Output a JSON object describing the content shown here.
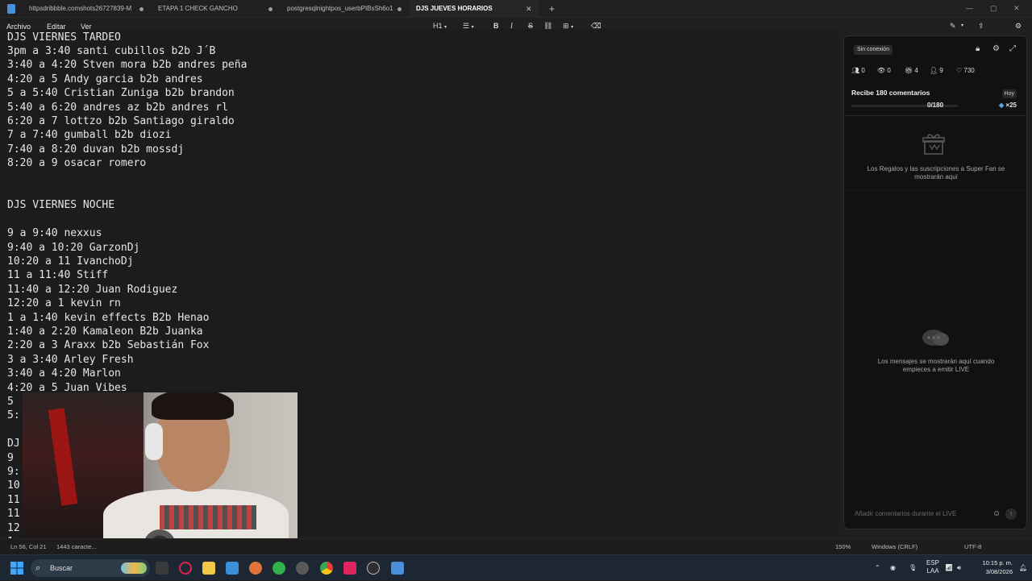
{
  "tabs": [
    {
      "label": "httpsdribbble.comshots26727839-M"
    },
    {
      "label": "ETAPA 1 CHECK GANCHO"
    },
    {
      "label": "postgresqlnightpos_userbPIBsSh6o1"
    },
    {
      "label": "DJS JUEVES HORARIOS"
    }
  ],
  "tab_add": "+",
  "window_controls": {
    "minimize": "—",
    "maximize": "▢",
    "close": "✕"
  },
  "menu": {
    "file": "Archivo",
    "edit": "Editar",
    "view": "Ver"
  },
  "format": {
    "heading": "H1",
    "bold": "B",
    "italic": "I",
    "strike": "S"
  },
  "document": {
    "lines": [
      "DJS VIERNES TARDEO",
      "3pm a 3:40 santi cubillos b2b J´B",
      "3:40 a 4:20 Stven mora b2b andres peña",
      "4:20 a 5 Andy garcia b2b andres",
      "5 a 5:40 Cristian Zuniga b2b brandon",
      "5:40 a 6:20 andres az b2b andres rl",
      "6:20 a 7 lottzo b2b Santiago giraldo",
      "7 a 7:40 gumball b2b diozi",
      "7:40 a 8:20 duvan b2b mossdj",
      "8:20 a 9 osacar romero",
      "",
      "",
      "DJS VIERNES NOCHE",
      "",
      "9 a 9:40 nexxus",
      "9:40 a 10:20 GarzonDj",
      "10:20 a 11 IvanchoDj",
      "11 a 11:40 Stiff",
      "11:40 a 12:20 Juan Rodiguez",
      "12:20 a 1 kevin rn",
      "1 a 1:40 kevin effects B2b Henao",
      "1:40 a 2:20 Kamaleon B2b Juanka",
      "2:20 a 3 Araxx b2b Sebastián Fox",
      "3 a 3:40 Arley Fresh",
      "3:40 a 4:20 Marlon",
      "4:20 a 5 Juan Vibes",
      "5",
      "5:",
      "",
      "DJ",
      "9",
      "9:",
      "10",
      "11",
      "11",
      "12",
      "1"
    ]
  },
  "panel": {
    "status_badge": "Sin conexión",
    "stats": {
      "users": "0",
      "viewers": "0",
      "gifts": "4",
      "followers": "9",
      "likes": "730"
    },
    "goal_title": "Recibe 180 comentarios",
    "goal_today": "Hoy",
    "goal_progress": 0.0,
    "goal_count": "0/180",
    "goal_multiplier": "×25",
    "gifts_empty_text": "Los Regalos y las suscripciones a Super Fan se mostrarán aquí",
    "chat_empty_text": "Los mensajes se mostrarán aquí cuando empieces a emitir LIVE",
    "comment_placeholder": "Añadir comentarios durante el LIVE"
  },
  "statusbar": {
    "position": "Ln 56, Col 21",
    "chars": "1443 caracte...",
    "zoom": "150%",
    "line_endings": "Windows (CRLF)",
    "encoding": "UTF-8"
  },
  "taskbar": {
    "search_label": "Buscar",
    "language": "ESP",
    "layout": "LAA",
    "time": "10:15 p. m.",
    "date": "3/08/2026"
  },
  "colors": {
    "accent": "#e0245e",
    "panel_bg": "#111111",
    "editor_bg": "#1c1c1c"
  }
}
